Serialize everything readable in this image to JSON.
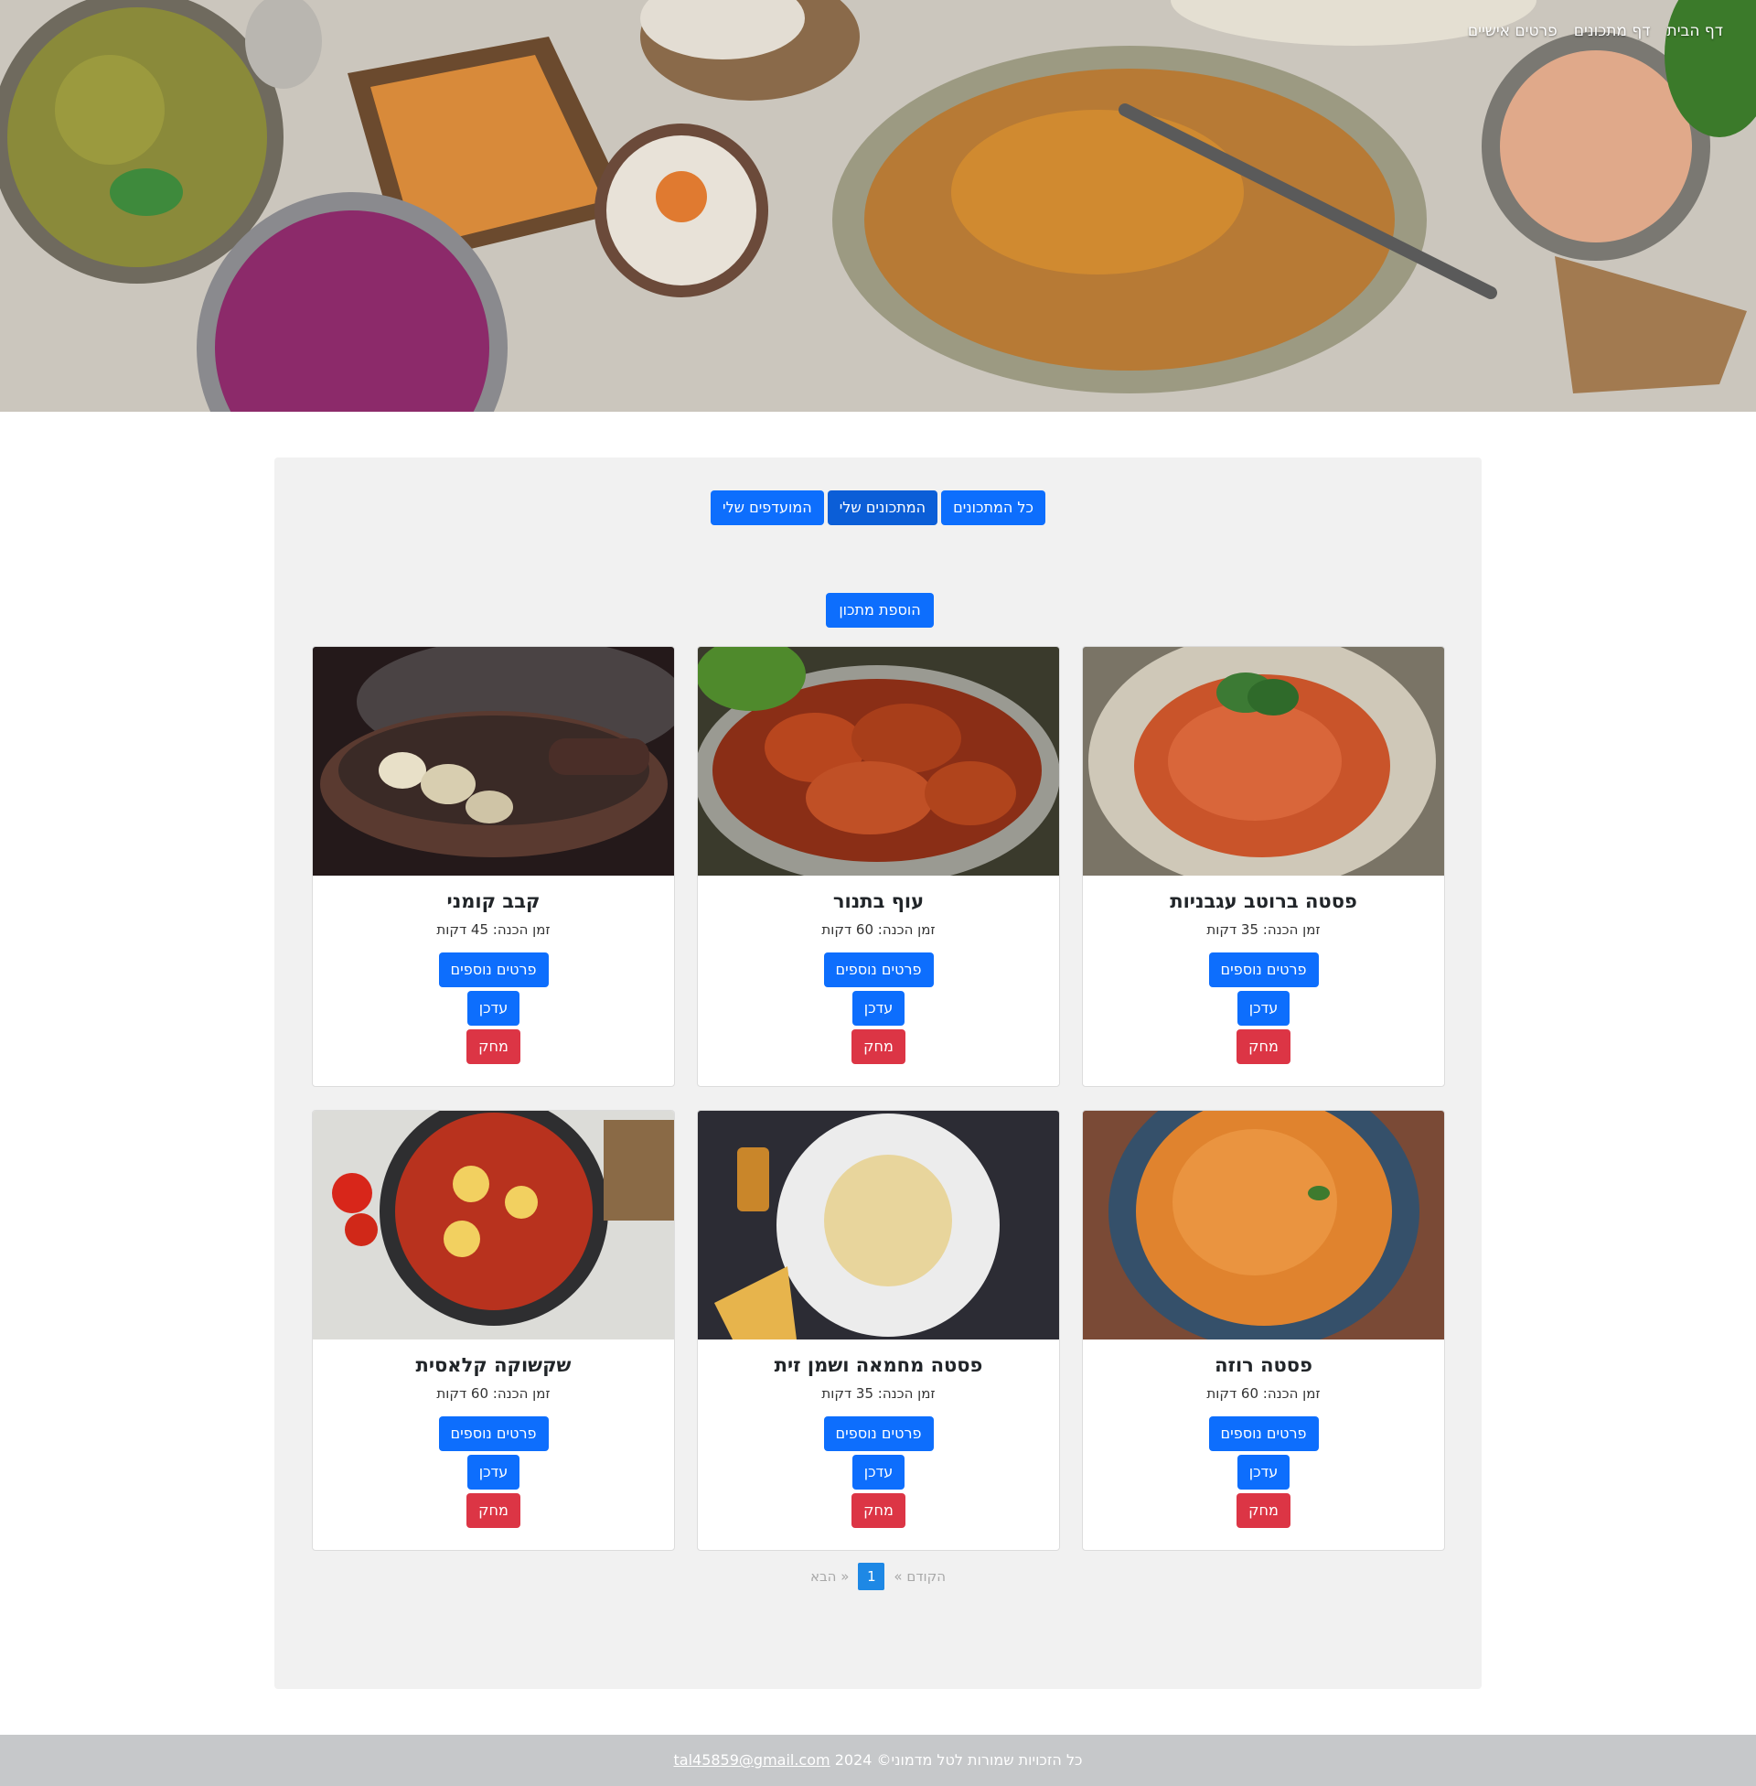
{
  "nav": {
    "items": [
      "דף הבית",
      "דף מתכונים",
      "פרטים אישיים"
    ]
  },
  "tabs": {
    "all_recipes": "כל המתכונים",
    "my_recipes": "המתכונים שלי",
    "favorites": "המועדפים שלי"
  },
  "add_recipe_label": "הוספת מתכון",
  "recipes": [
    {
      "title": "פסטה ברוטב עגבניות",
      "time": "זמן הכנה: 35 דקות"
    },
    {
      "title": "עוף בתנור",
      "time": "זמן הכנה: 60 דקות"
    },
    {
      "title": "קבב קומני",
      "time": "זמן הכנה: 45 דקות"
    },
    {
      "title": "פסטה רוזה",
      "time": "זמן הכנה: 60 דקות"
    },
    {
      "title": "פסטה מחמאה ושמן זית",
      "time": "זמן הכנה: 35 דקות"
    },
    {
      "title": "שקשוקה קלאסית",
      "time": "זמן הכנה: 60 דקות"
    }
  ],
  "card_buttons": {
    "details": "פרטים נוספים",
    "update": "עדכן",
    "delete": "מחק"
  },
  "pagination": {
    "prev": "« הקודם",
    "current": "1",
    "next": "הבא »"
  },
  "footer": {
    "text": "כל הזכויות שמורות לטל מדמוני© 2024",
    "email": "tal45859@gmail.com"
  },
  "colors": {
    "primary": "#0d6efd",
    "danger": "#dc3545",
    "panel": "#f1f1f1",
    "footer": "#c6c8ca"
  }
}
